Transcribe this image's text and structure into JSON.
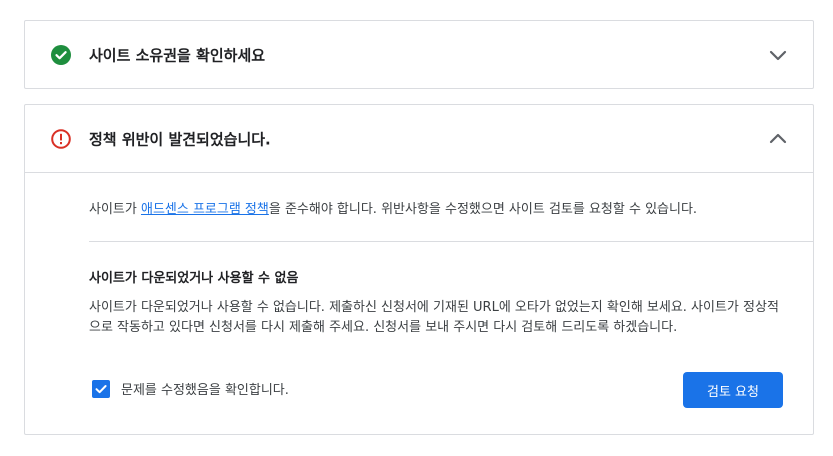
{
  "cards": {
    "ownership": {
      "title": "사이트 소유권을 확인하세요",
      "status_icon": "check-circle-icon",
      "status_color": "#1e8e3e",
      "expanded": false,
      "chevron_icon": "chevron-down-icon"
    },
    "policy": {
      "title": "정책 위반이 발견되었습니다.",
      "status_icon": "error-circle-icon",
      "status_color": "#d93025",
      "expanded": true,
      "chevron_icon": "chevron-up-icon",
      "intro_prefix": "사이트가 ",
      "intro_link": "애드센스 프로그램 정책",
      "intro_suffix": "을 준수해야 합니다. 위반사항을 수정했으면 사이트 검토를 요청할 수 있습니다.",
      "issue_title": "사이트가 다운되었거나 사용할 수 없음",
      "issue_text": "사이트가 다운되었거나 사용할 수 없습니다. 제출하신 신청서에 기재된 URL에 오타가 없었는지 확인해 보세요. 사이트가 정상적으로 작동하고 있다면 신청서를 다시 제출해 주세요. 신청서를 보내 주시면 다시 검토해 드리도록 하겠습니다.",
      "confirm_label": "문제를 수정했음을 확인합니다.",
      "confirm_checked": true,
      "review_button": "검토 요청"
    }
  },
  "colors": {
    "accent": "#1a73e8",
    "border": "#dadce0"
  }
}
